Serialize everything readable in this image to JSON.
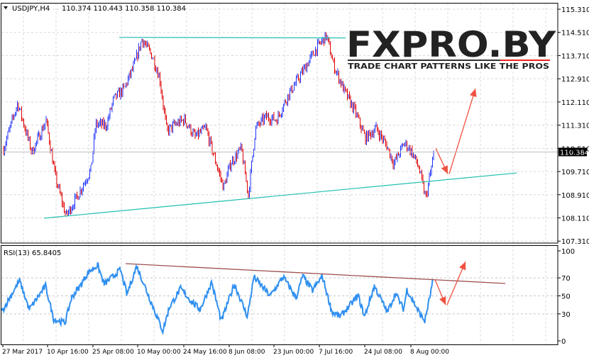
{
  "header": {
    "symbol": "USDJPY,H4",
    "ohlc": "110.374 110.443 110.358 110.384"
  },
  "logo": {
    "brand": "FXPRO.BY",
    "tagline": "TRADE CHART PATTERNS LIKE THE PROS"
  },
  "colors": {
    "up": "#1e32ff",
    "down": "#e00000",
    "trendline": "#20c0b0",
    "rsi": "#2f8ff0",
    "rsi_trend": "#a05050",
    "arrow": "#f05040"
  },
  "chart_data": [
    {
      "type": "ohlc",
      "title": "USDJPY,H4",
      "current_price": "110.384",
      "ylim": [
        107.31,
        115.51
      ],
      "y_ticks": [
        "115.310",
        "114.510",
        "113.710",
        "112.910",
        "112.110",
        "111.310",
        "110.510",
        "109.710",
        "108.910",
        "108.110",
        "107.310"
      ],
      "x_ticks": [
        "27 Mar 2017",
        "10 Apr 16:00",
        "25 Apr 08:00",
        "10 May 00:00",
        "24 May 16:00",
        "8 Jun 08:00",
        "23 Jun 00:00",
        "7 Jul 16:00",
        "24 Jul 08:00",
        "8 Aug 00:00"
      ],
      "approx_closes": [
        110.49,
        112.08,
        110.37,
        111.47,
        109.52,
        108.17,
        108.9,
        109.4,
        109.76,
        111.35,
        111.3,
        112.2,
        112.57,
        113.43,
        114.28,
        113.67,
        112.94,
        111.1,
        111.3,
        111.5,
        110.9,
        111.2,
        110.37,
        109.15,
        110.0,
        110.5,
        108.9,
        111.2,
        111.6,
        111.5,
        112.3,
        112.7,
        113.3,
        113.93,
        114.4,
        113.4,
        112.5,
        111.8,
        110.86,
        111.2,
        110.6,
        109.98,
        110.7,
        110.4,
        109.86,
        108.78,
        110.38
      ],
      "annotations": {
        "resistance": [
          114.34,
          114.32
        ],
        "support": [
          108.1,
          109.66
        ],
        "projection": [
          110.51,
          109.63,
          112.57
        ]
      }
    },
    {
      "type": "line",
      "title": "RSI(13) 65.8405",
      "ylim": [
        0,
        100
      ],
      "y_ticks": [
        "100",
        "70",
        "50",
        "30",
        "0"
      ],
      "values": [
        32,
        48,
        67,
        35,
        61,
        24,
        20,
        48,
        63,
        76,
        84,
        63,
        79,
        52,
        83,
        56,
        11,
        37,
        58,
        43,
        35,
        65,
        22,
        63,
        27,
        71,
        50,
        71,
        48,
        72,
        56,
        72,
        32,
        27,
        50,
        27,
        61,
        32,
        53,
        35,
        57,
        30,
        22,
        48,
        67
      ],
      "trendline": [
        85.8,
        63.8
      ],
      "projection": [
        68,
        40,
        88
      ]
    }
  ]
}
